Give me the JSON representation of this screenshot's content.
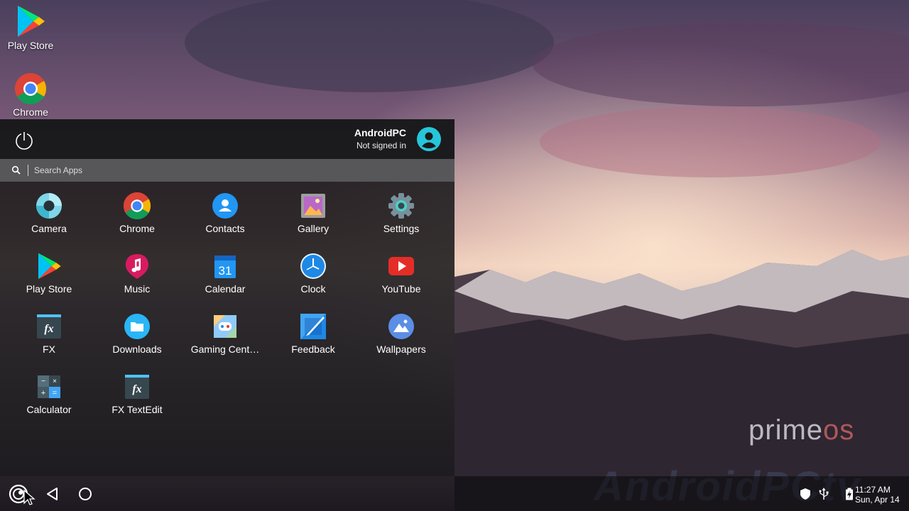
{
  "desktop": {
    "icons": [
      {
        "label": "Play Store",
        "icon": "play-store-icon"
      },
      {
        "label": "Chrome",
        "icon": "chrome-icon"
      }
    ]
  },
  "menu": {
    "user_name": "AndroidPC",
    "user_status": "Not signed in",
    "search_placeholder": "Search Apps",
    "apps": [
      {
        "label": "Camera",
        "icon": "camera-icon"
      },
      {
        "label": "Chrome",
        "icon": "chrome-icon"
      },
      {
        "label": "Contacts",
        "icon": "contacts-icon"
      },
      {
        "label": "Gallery",
        "icon": "gallery-icon"
      },
      {
        "label": "Settings",
        "icon": "settings-icon"
      },
      {
        "label": "Play Store",
        "icon": "play-store-icon"
      },
      {
        "label": "Music",
        "icon": "music-icon"
      },
      {
        "label": "Calendar",
        "icon": "calendar-icon"
      },
      {
        "label": "Clock",
        "icon": "clock-icon"
      },
      {
        "label": "YouTube",
        "icon": "youtube-icon"
      },
      {
        "label": "FX",
        "icon": "fx-icon"
      },
      {
        "label": "Downloads",
        "icon": "downloads-icon"
      },
      {
        "label": "Gaming Cent…",
        "icon": "gaming-center-icon"
      },
      {
        "label": "Feedback",
        "icon": "feedback-icon"
      },
      {
        "label": "Wallpapers",
        "icon": "wallpapers-icon"
      },
      {
        "label": "Calculator",
        "icon": "calculator-icon"
      },
      {
        "label": "FX TextEdit",
        "icon": "fx-textedit-icon"
      }
    ],
    "calendar_day": "31"
  },
  "watermarks": {
    "prime": "prime",
    "os": "os",
    "channel": "AndroidPCtv"
  },
  "taskbar": {
    "time": "11:27 AM",
    "date": "Sun, Apr 14"
  },
  "colors": {
    "avatar": "#26c6da",
    "youtube": "#e52d27",
    "music": "#d81b60"
  }
}
